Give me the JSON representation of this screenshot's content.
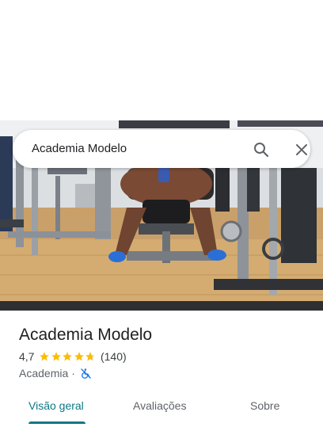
{
  "search": {
    "query": "Academia Modelo",
    "search_icon": "search-icon",
    "close_icon": "close-icon"
  },
  "hero_image": {
    "subject": "gym-mirror-selfie"
  },
  "place": {
    "title": "Academia Modelo",
    "rating": "4,7",
    "rating_value": 4.7,
    "stars_max": 5,
    "review_count": "(140)",
    "category": "Academia",
    "separator": "·",
    "accessibility_icon": "wheelchair-inaccessible-icon"
  },
  "tabs": [
    {
      "label": "Visão geral",
      "active": true
    },
    {
      "label": "Avaliações",
      "active": false
    },
    {
      "label": "Sobre",
      "active": false
    }
  ],
  "colors": {
    "accent": "#0b7885",
    "star": "#fbbc04",
    "accessibility": "#1a73e8",
    "title_text": "#202124",
    "secondary_text": "#5f6368"
  }
}
